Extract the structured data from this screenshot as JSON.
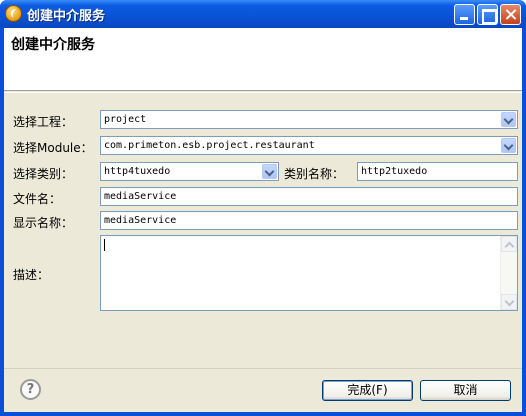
{
  "window": {
    "title": "创建中介服务"
  },
  "banner": {
    "title": "创建中介服务"
  },
  "form": {
    "project_label": "选择工程：",
    "project_value": "project",
    "module_label": "选择Module：",
    "module_value": "com.primeton.esb.project.restaurant",
    "category_label": "选择类别：",
    "category_value": "http4tuxedo",
    "category_name_label": "类别名称：",
    "category_name_value": "http2tuxedo",
    "filename_label": "文件名：",
    "filename_value": "mediaService",
    "display_name_label": "显示名称：",
    "display_name_value": "mediaService",
    "description_label": "描述：",
    "description_value": ""
  },
  "buttons": {
    "help": "?",
    "finish": "完成(F)",
    "cancel": "取消"
  },
  "colors": {
    "titlebar": "#0a52d4",
    "dialog_bg": "#ece9d8",
    "field_border": "#7f9db9"
  }
}
